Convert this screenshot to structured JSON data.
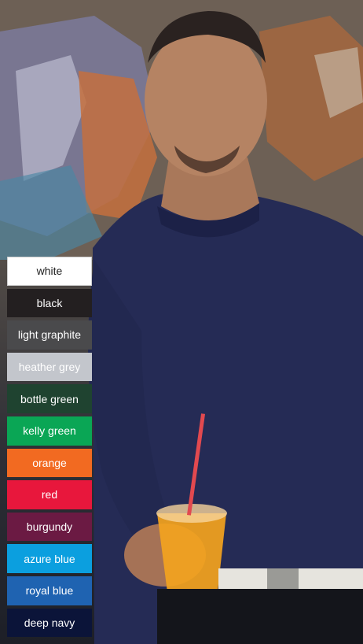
{
  "photo": {
    "subject": "man in navy sweatshirt holding orange drink in front of graffiti wall"
  },
  "swatches": [
    {
      "label": "white",
      "color": "#ffffff"
    },
    {
      "label": "black",
      "color": "#231f20"
    },
    {
      "label": "light graphite",
      "color": "#4a4a4c"
    },
    {
      "label": "heather grey",
      "color": "#c3c6cc"
    },
    {
      "label": "bottle green",
      "color": "#1f4330"
    },
    {
      "label": "kelly green",
      "color": "#0aa655"
    },
    {
      "label": "orange",
      "color": "#f26a21"
    },
    {
      "label": "red",
      "color": "#e8173c"
    },
    {
      "label": "burgundy",
      "color": "#6b1a43"
    },
    {
      "label": "azure blue",
      "color": "#0b9fdf"
    },
    {
      "label": "royal blue",
      "color": "#1f63b1"
    },
    {
      "label": "deep navy",
      "color": "#0b1439"
    }
  ]
}
